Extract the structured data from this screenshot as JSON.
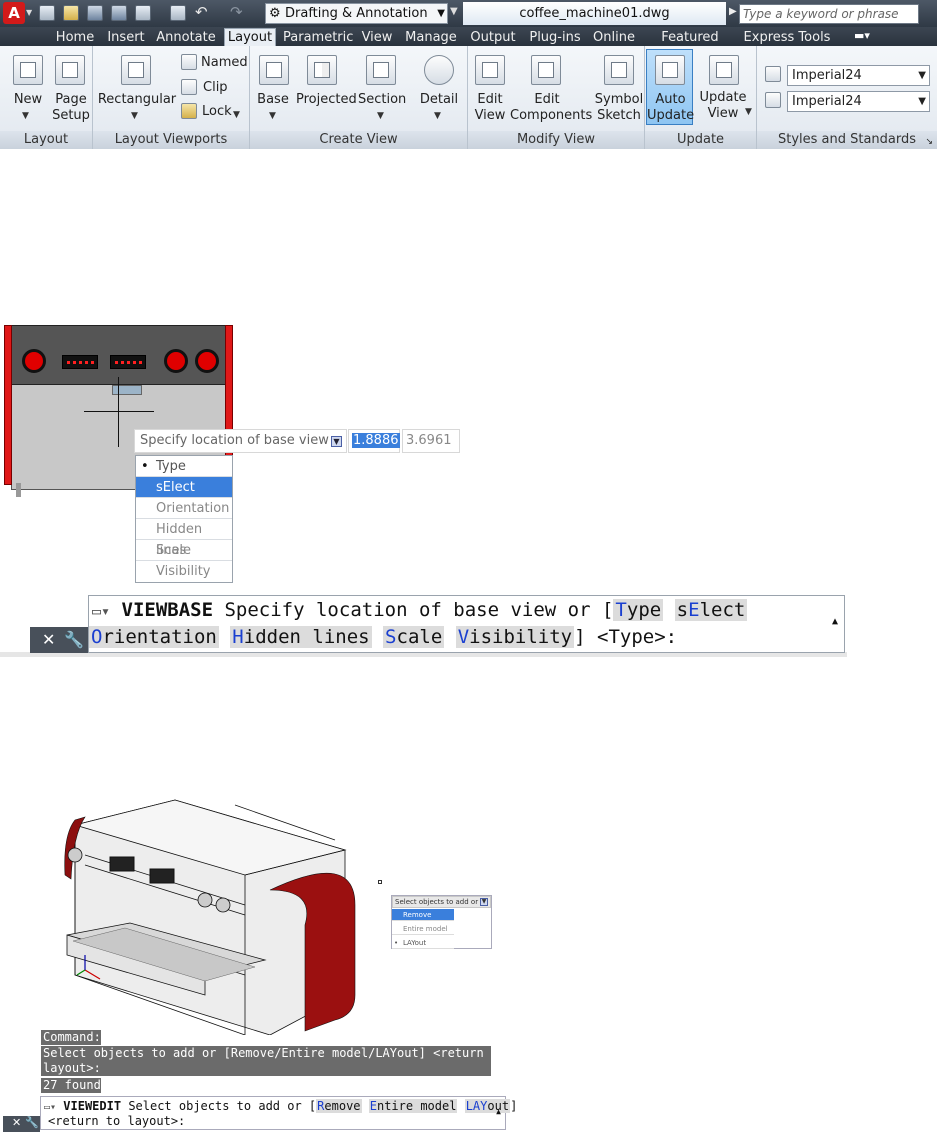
{
  "titlebar": {
    "workspace": "Drafting & Annotation",
    "filename": "coffee_machine01.dwg",
    "search_placeholder": "Type a keyword or phrase"
  },
  "tabs": [
    "Home",
    "Insert",
    "Annotate",
    "Layout",
    "Parametric",
    "View",
    "Manage",
    "Output",
    "Plug-ins",
    "Online",
    "Featured Apps",
    "Express Tools"
  ],
  "active_tab": "Layout",
  "ribbon": {
    "layout_panel": {
      "title": "Layout",
      "new_label": "New",
      "page_setup_label": "Page\nSetup"
    },
    "viewports_panel": {
      "title": "Layout Viewports",
      "rectangular_label": "Rectangular",
      "named_label": "Named",
      "clip_label": "Clip",
      "lock_label": "Lock"
    },
    "create_view_panel": {
      "title": "Create View",
      "base_label": "Base",
      "projected_label": "Projected",
      "section_label": "Section",
      "detail_label": "Detail"
    },
    "modify_view_panel": {
      "title": "Modify View",
      "edit_view_label": "Edit\nView",
      "edit_components_label": "Edit\nComponents",
      "symbol_sketch_label": "Symbol\nSketch"
    },
    "update_panel": {
      "title": "Update",
      "auto_update_label": "Auto\nUpdate",
      "update_view_label": "Update\nView"
    },
    "styles_panel": {
      "title": "Styles and Standards",
      "style1": "Imperial24",
      "style2": "Imperial24"
    }
  },
  "viewbase": {
    "tooltip": "Specify location of base view or",
    "x_value": "1.8886",
    "y_value": "3.6961",
    "menu": [
      "Type",
      "sElect",
      "Orientation",
      "Hidden lines",
      "Scale",
      "Visibility"
    ],
    "menu_selected": "Type",
    "menu_highlighted": "sElect",
    "command_name": "VIEWBASE",
    "prompt_text": "Specify location of base view or [",
    "options": [
      {
        "key": "T",
        "rest": "ype"
      },
      {
        "pre": "s",
        "key": "E",
        "rest": "lect"
      },
      {
        "key": "O",
        "rest": "rientation"
      },
      {
        "key": "H",
        "rest": "idden lines"
      },
      {
        "key": "S",
        "rest": "cale"
      },
      {
        "key": "V",
        "rest": "isibility"
      }
    ],
    "prompt_tail": "] <Type>:"
  },
  "viewedit": {
    "menu_header": "Select objects to add or",
    "menu": [
      "Remove",
      "Entire model",
      "LAYout"
    ],
    "menu_selected": "LAYout",
    "menu_highlighted": "Remove",
    "history": [
      "Command:",
      "Select objects to add or [Remove/Entire model/LAYout] <return to",
      "layout>:",
      "27 found"
    ],
    "command_name": "VIEWEDIT",
    "prompt_text": "Select objects to add or [",
    "options": [
      {
        "key": "R",
        "rest": "emove"
      },
      {
        "key": "E",
        "rest": "ntire model"
      },
      {
        "key": "LAY",
        "rest": "out"
      }
    ],
    "prompt_tail": "]",
    "prompt_line2": "<return to layout>:"
  },
  "colors": {
    "accent_blue": "#3a7fdc",
    "option_key": "#1a3fd0",
    "machine_red": "#e01818"
  }
}
